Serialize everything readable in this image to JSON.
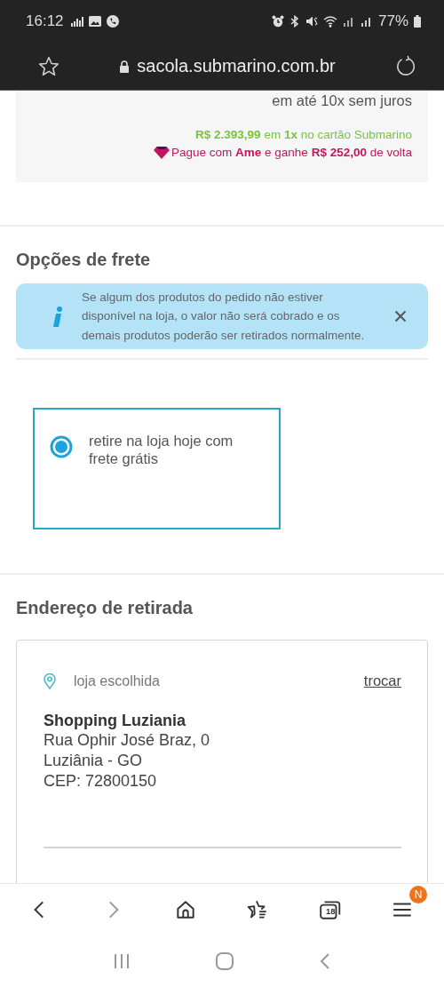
{
  "status_bar": {
    "time": "16:12",
    "battery": "77%"
  },
  "address_bar": {
    "url": "sacola.submarino.com.br"
  },
  "payment": {
    "installments": "em até 10x sem juros",
    "card_offer": "**R$ 2.393,99** em **1x** no cartão Submarino",
    "ame_offer": "Pague com **Ame** e ganhe **R$ 252,00** de volta"
  },
  "shipping": {
    "heading": "Opções de frete",
    "notice": {
      "text": "Se algum dos produtos do pedido não estiver disponível na loja, o valor não será cobrado e os demais produtos poderão ser retirados normalmente."
    },
    "options": [
      {
        "label": "retire na loja hoje com frete grátis",
        "selected": true
      }
    ]
  },
  "pickup": {
    "heading": "Endereço de retirada",
    "card": {
      "label": "loja escolhida",
      "action": "trocar",
      "store_name": "Shopping Luziania",
      "address_lines": [
        "Rua Ophir José Braz, 0",
        "Luziânia - GO",
        "CEP: 72800150"
      ]
    }
  },
  "browser_toolbar": [
    {
      "kind": "back",
      "disabled": false
    },
    {
      "kind": "forward",
      "disabled": true
    },
    {
      "kind": "home",
      "disabled": false
    },
    {
      "kind": "bookmarks",
      "disabled": false
    },
    {
      "kind": "tabs",
      "disabled": false,
      "count": "18"
    },
    {
      "kind": "menu",
      "disabled": false,
      "badge": "N"
    }
  ]
}
